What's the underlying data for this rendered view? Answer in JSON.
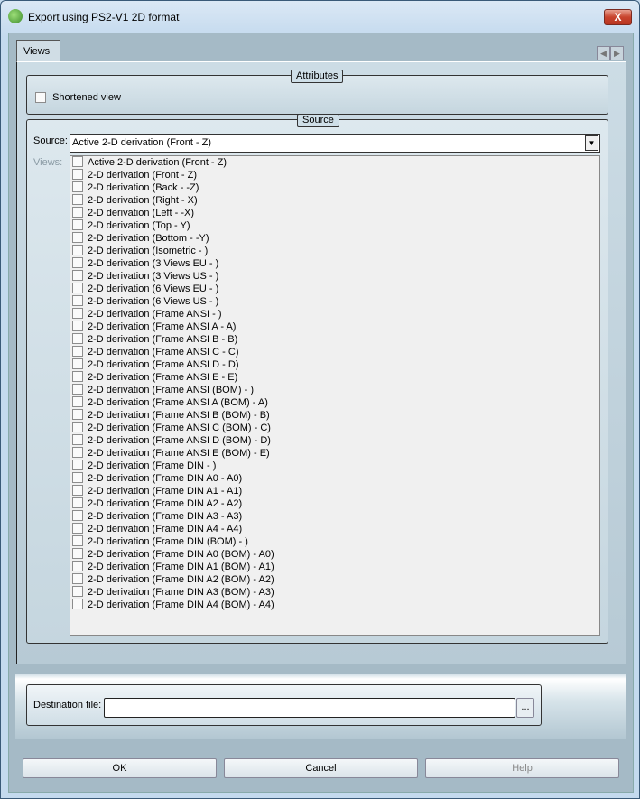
{
  "window": {
    "title": "Export using PS2-V1 2D format",
    "close_label": "X"
  },
  "tabs": [
    {
      "label": "Views"
    }
  ],
  "attributes": {
    "legend": "Attributes",
    "shortened_view_label": "Shortened view",
    "shortened_view_checked": false
  },
  "source": {
    "legend": "Source",
    "source_label": "Source:",
    "source_value": "Active 2-D derivation (Front - Z)",
    "views_label": "Views:",
    "views": [
      "Active 2-D derivation (Front - Z)",
      "2-D derivation (Front - Z)",
      "2-D derivation (Back - -Z)",
      "2-D derivation (Right - X)",
      "2-D derivation (Left - -X)",
      "2-D derivation (Top - Y)",
      "2-D derivation (Bottom - -Y)",
      "2-D derivation (Isometric - )",
      "2-D derivation (3 Views EU - )",
      "2-D derivation (3 Views US - )",
      "2-D derivation (6 Views EU - )",
      "2-D derivation (6 Views US - )",
      "2-D derivation (Frame ANSI - )",
      "2-D derivation (Frame ANSI A - A)",
      "2-D derivation (Frame ANSI B - B)",
      "2-D derivation (Frame ANSI C - C)",
      "2-D derivation (Frame ANSI D - D)",
      "2-D derivation (Frame ANSI E - E)",
      "2-D derivation (Frame ANSI (BOM) - )",
      "2-D derivation (Frame ANSI A (BOM) - A)",
      "2-D derivation (Frame ANSI B (BOM) - B)",
      "2-D derivation (Frame ANSI C (BOM) - C)",
      "2-D derivation (Frame ANSI D (BOM) - D)",
      "2-D derivation (Frame ANSI E (BOM) - E)",
      "2-D derivation (Frame DIN - )",
      "2-D derivation (Frame DIN A0 - A0)",
      "2-D derivation (Frame DIN A1 - A1)",
      "2-D derivation (Frame DIN A2 - A2)",
      "2-D derivation (Frame DIN A3 - A3)",
      "2-D derivation (Frame DIN A4 - A4)",
      "2-D derivation (Frame DIN (BOM) - )",
      "2-D derivation (Frame DIN A0 (BOM) - A0)",
      "2-D derivation (Frame DIN A1 (BOM) - A1)",
      "2-D derivation (Frame DIN A2 (BOM) - A2)",
      "2-D derivation (Frame DIN A3 (BOM) - A3)",
      "2-D derivation (Frame DIN A4 (BOM) - A4)"
    ]
  },
  "destination": {
    "label": "Destination file:",
    "value": "",
    "browse_label": "..."
  },
  "buttons": {
    "ok": "OK",
    "cancel": "Cancel",
    "help": "Help"
  }
}
